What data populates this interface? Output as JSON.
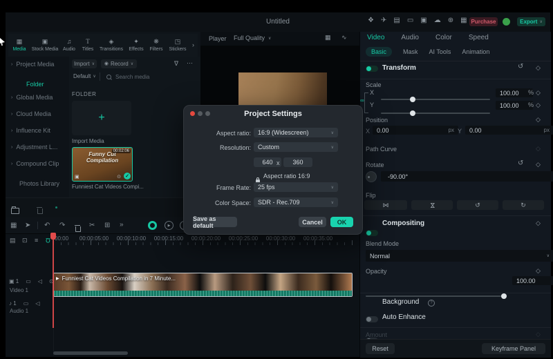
{
  "window": {
    "title": "Untitled"
  },
  "topbar": {
    "icons": [
      "gift-icon",
      "send-icon",
      "keyboard-icon",
      "display-icon",
      "save-icon",
      "cloud-upload-icon",
      "globe-icon",
      "apps-grid-icon"
    ],
    "purchase": "Purchase",
    "export": "Export"
  },
  "media_tabs": {
    "items": [
      {
        "label": "Media"
      },
      {
        "label": "Stock Media"
      },
      {
        "label": "Audio"
      },
      {
        "label": "Titles"
      },
      {
        "label": "Transitions"
      },
      {
        "label": "Effects"
      },
      {
        "label": "Filters"
      },
      {
        "label": "Stickers"
      }
    ]
  },
  "sidebar": {
    "items": [
      {
        "label": "Project Media"
      },
      {
        "label": "Folder"
      },
      {
        "label": "Global Media"
      },
      {
        "label": "Cloud Media"
      },
      {
        "label": "Influence Kit"
      },
      {
        "label": "Adjustment L..."
      },
      {
        "label": "Compound Clip"
      },
      {
        "label": "Photos Library"
      }
    ]
  },
  "media_panel": {
    "import_button": "Import",
    "record_button": "Record",
    "sort": "Default",
    "search_placeholder": "Search media",
    "section_header": "FOLDER",
    "import_tile_label": "Import Media",
    "clip": {
      "thumb_line1": "Funny Cut",
      "thumb_line2": "Compilation",
      "duration": "00:02:06",
      "caption": "Funniest Cat Videos Compi..."
    }
  },
  "player": {
    "label": "Player",
    "quality": "Full Quality"
  },
  "dialog": {
    "title": "Project Settings",
    "aspect_label": "Aspect ratio:",
    "aspect_value": "16:9 (Widescreen)",
    "resolution_label": "Resolution:",
    "resolution_value": "Custom",
    "width_value": "640",
    "x_sep": "x",
    "height_value": "360",
    "lock_note": "Aspect ratio 16:9",
    "framerate_label": "Frame Rate:",
    "framerate_value": "25 fps",
    "colorspace_label": "Color Space:",
    "colorspace_value": "SDR - Rec.709",
    "save_default": "Save as default",
    "cancel": "Cancel",
    "ok": "OK"
  },
  "right_panel": {
    "tabs": [
      {
        "label": "Video"
      },
      {
        "label": "Audio"
      },
      {
        "label": "Color"
      },
      {
        "label": "Speed"
      }
    ],
    "subtabs": [
      {
        "label": "Basic"
      },
      {
        "label": "Mask"
      },
      {
        "label": "AI Tools"
      },
      {
        "label": "Animation"
      }
    ],
    "transform": {
      "title": "Transform",
      "scale": "Scale",
      "x": "X",
      "y": "Y",
      "scale_x": "100.00",
      "scale_y": "100.00",
      "unit": "%",
      "position": "Position",
      "pos_x": "0.00",
      "pos_y": "0.00",
      "px": "px",
      "path_curve": "Path Curve",
      "rotate": "Rotate",
      "rotate_value": "-90.00°",
      "flip": "Flip"
    },
    "compositing": {
      "title": "Compositing",
      "blend_label": "Blend Mode",
      "blend_value": "Normal",
      "opacity_label": "Opacity",
      "opacity_value": "100.00"
    },
    "background_label": "Background",
    "auto_enhance_label": "Auto Enhance",
    "amount_label": "Amount",
    "footer": {
      "reset": "Reset",
      "keyframe": "Keyframe Panel"
    }
  },
  "timeline": {
    "ruler": [
      "00:00",
      "00:00:05:00",
      "00:00:10:00",
      "00:00:15:00",
      "00:00:20:00",
      "00:00:25:00",
      "00:00:30:00",
      "00:00:35:00"
    ],
    "clip_label": "Funniest Cat Videos Compilation in 7 Minute...",
    "video_track": {
      "label": "Video 1",
      "num": "1"
    },
    "audio_track": {
      "label": "Audio 1",
      "num": "1"
    }
  },
  "colors": {
    "accent_teal": "#17c9a4",
    "ok_button": "#19d3ae",
    "playhead_red": "#e24b4b",
    "purchase_red": "#d05a6a",
    "avatar_green": "#3aa04a"
  }
}
